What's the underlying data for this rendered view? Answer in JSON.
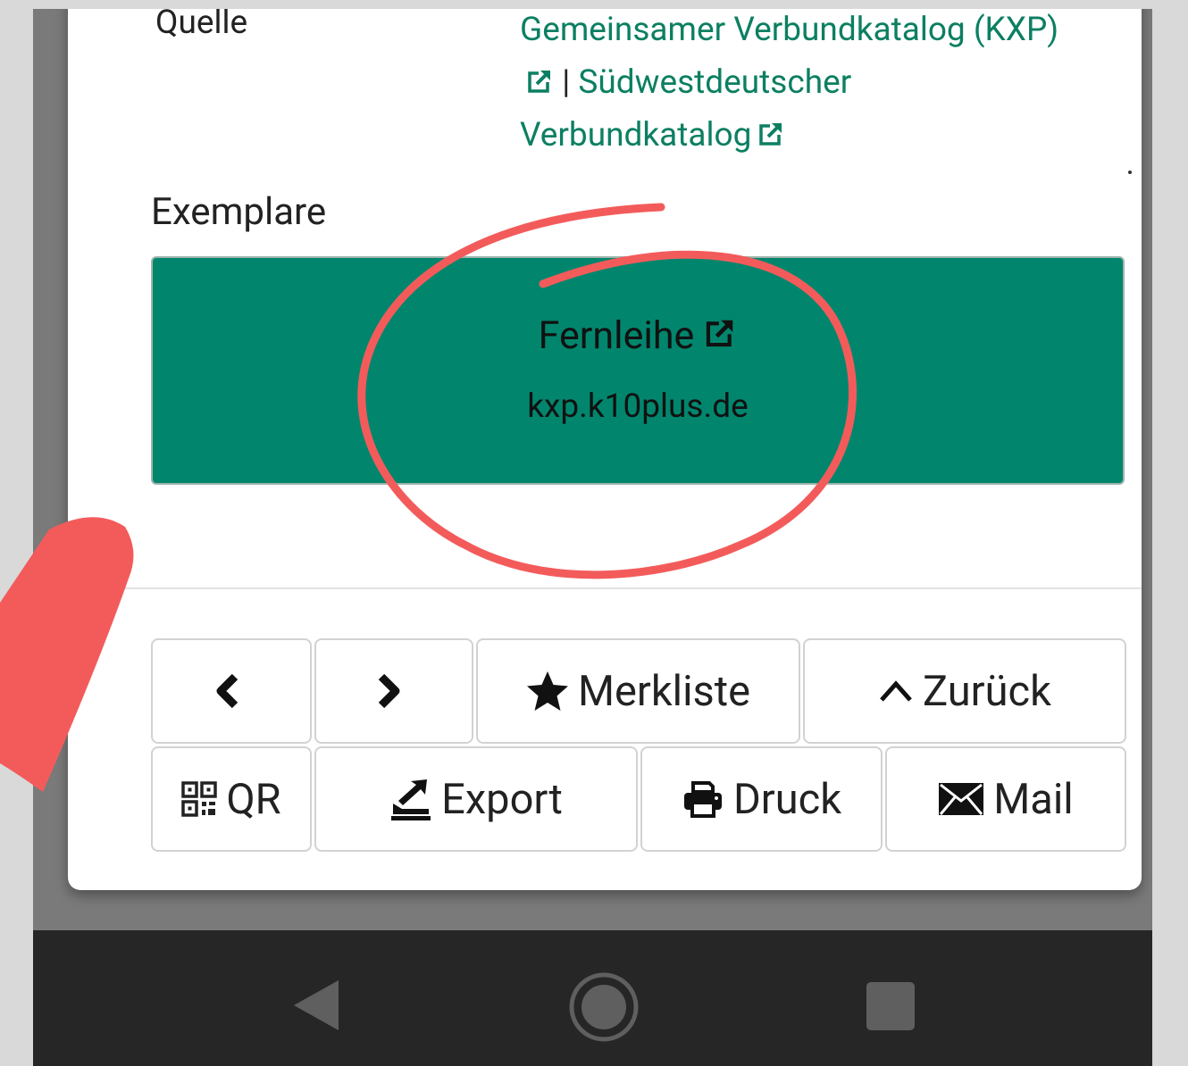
{
  "details": {
    "source_label": "Quelle",
    "source_link_1": "Gemeinsamer Verbundkatalog (KXP)",
    "separator": "|",
    "source_link_2": "Südwestdeutscher Verbundkatalog"
  },
  "exemplare": {
    "title": "Exemplare",
    "button_label": "Fernleihe",
    "button_domain": "kxp.k10plus.de"
  },
  "actions": {
    "prev_label": "",
    "next_label": "",
    "merkliste": "Merkliste",
    "zurueck": "Zurück",
    "qr": "QR",
    "export": "Export",
    "druck": "Druck",
    "mail": "Mail"
  },
  "colors": {
    "link": "#0c7f62",
    "button_green": "#01866d",
    "annotation_red": "#f35b5b",
    "navbar": "#262626"
  },
  "icons": [
    "external-link-icon",
    "chevron-left-icon",
    "chevron-right-icon",
    "star-icon",
    "chevron-up-icon",
    "qr-code-icon",
    "export-icon",
    "print-icon",
    "mail-icon",
    "back-triangle-icon",
    "home-circle-icon",
    "recents-square-icon"
  ]
}
